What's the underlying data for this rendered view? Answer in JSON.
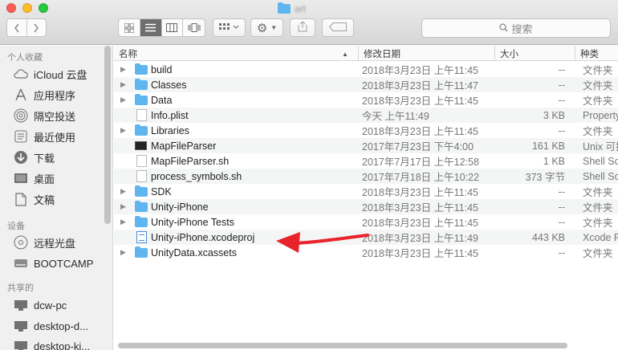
{
  "window": {
    "title": "art",
    "accent": "#5fb6ef"
  },
  "toolbar": {
    "search_placeholder": "搜索",
    "icons": [
      "chevron-left-icon",
      "chevron-right-icon",
      "icon-view-icon",
      "list-view-icon",
      "column-view-icon",
      "cover-flow-icon",
      "arrange-icon",
      "gear-icon",
      "share-icon",
      "tag-icon",
      "search-icon"
    ]
  },
  "sidebar": {
    "favorites_title": "个人收藏",
    "favorites": [
      {
        "label": "iCloud 云盘",
        "icon": "cloud-icon"
      },
      {
        "label": "应用程序",
        "icon": "applications-icon"
      },
      {
        "label": "隔空投送",
        "icon": "airdrop-icon"
      },
      {
        "label": "最近使用",
        "icon": "recents-icon"
      },
      {
        "label": "下载",
        "icon": "download-icon"
      },
      {
        "label": "桌面",
        "icon": "desktop-icon"
      },
      {
        "label": "文稿",
        "icon": "documents-icon"
      }
    ],
    "devices_title": "设备",
    "devices": [
      {
        "label": "远程光盘",
        "icon": "disc-icon"
      },
      {
        "label": "BOOTCAMP",
        "icon": "drive-icon"
      }
    ],
    "shared_title": "共享的",
    "shared": [
      {
        "label": "dcw-pc",
        "icon": "computer-icon"
      },
      {
        "label": "desktop-d...",
        "icon": "computer-icon"
      },
      {
        "label": "desktop-ki...",
        "icon": "computer-icon"
      }
    ]
  },
  "columns": {
    "name": "名称",
    "date": "修改日期",
    "size": "大小",
    "kind": "种类"
  },
  "files": [
    {
      "name": "build",
      "type": "folder",
      "date": "2018年3月23日 上午11:45",
      "size": "--",
      "kind": "文件夹"
    },
    {
      "name": "Classes",
      "type": "folder",
      "date": "2018年3月23日 上午11:47",
      "size": "--",
      "kind": "文件夹"
    },
    {
      "name": "Data",
      "type": "folder",
      "date": "2018年3月23日 上午11:45",
      "size": "--",
      "kind": "文件夹"
    },
    {
      "name": "Info.plist",
      "type": "doc",
      "date": "今天 上午11:49",
      "size": "3 KB",
      "kind": "Property"
    },
    {
      "name": "Libraries",
      "type": "folder",
      "date": "2018年3月23日 上午11:45",
      "size": "--",
      "kind": "文件夹"
    },
    {
      "name": "MapFileParser",
      "type": "unix",
      "date": "2017年7月23日 下午4:00",
      "size": "161 KB",
      "kind": "Unix 可执"
    },
    {
      "name": "MapFileParser.sh",
      "type": "doc",
      "date": "2017年7月17日 上午12:58",
      "size": "1 KB",
      "kind": "Shell Sc"
    },
    {
      "name": "process_symbols.sh",
      "type": "doc",
      "date": "2017年7月18日 上午10:22",
      "size": "373 字节",
      "kind": "Shell Sc"
    },
    {
      "name": "SDK",
      "type": "folder",
      "date": "2018年3月23日 上午11:45",
      "size": "--",
      "kind": "文件夹"
    },
    {
      "name": "Unity-iPhone",
      "type": "folder",
      "date": "2018年3月23日 上午11:45",
      "size": "--",
      "kind": "文件夹"
    },
    {
      "name": "Unity-iPhone Tests",
      "type": "folder",
      "date": "2018年3月23日 上午11:45",
      "size": "--",
      "kind": "文件夹"
    },
    {
      "name": "Unity-iPhone.xcodeproj",
      "type": "proj",
      "date": "2018年3月23日 上午11:49",
      "size": "443 KB",
      "kind": "Xcode P"
    },
    {
      "name": "UnityData.xcassets",
      "type": "folder",
      "date": "2018年3月23日 上午11:45",
      "size": "--",
      "kind": "文件夹"
    }
  ],
  "annotation": {
    "color": "#e8242a"
  }
}
